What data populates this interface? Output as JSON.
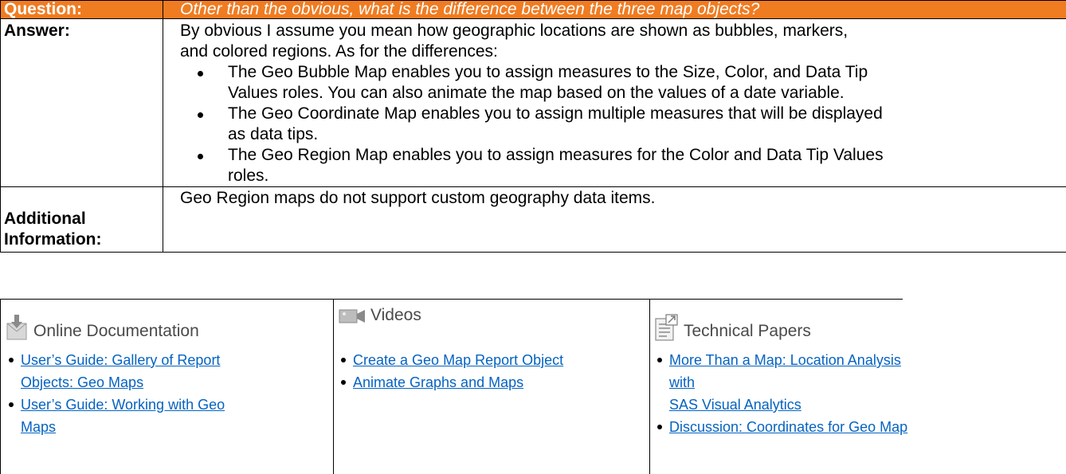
{
  "question": {
    "label": "Question:",
    "text": "Other than the obvious, what is the difference between the three map objects?"
  },
  "answer": {
    "label": "Answer:",
    "intro_line1": "By obvious I assume you mean how geographic locations are shown as bubbles, markers,",
    "intro_line2": "and colored regions. As for the differences:",
    "bullets": [
      {
        "line1": "The Geo Bubble Map enables you to assign measures to the Size, Color, and Data Tip",
        "line2": "Values roles. You can also animate the map based on the values of a date variable."
      },
      {
        "line1": "The Geo Coordinate Map enables you to assign multiple measures that will be displayed",
        "line2": "as data tips."
      },
      {
        "line1": "The Geo Region Map enables you to assign measures for the Color and Data Tip Values",
        "line2": "roles."
      }
    ]
  },
  "additional": {
    "label_line1": "Additional",
    "label_line2": "Information:",
    "text": "Geo Region maps do not support custom geography data items."
  },
  "resources": {
    "documentation": {
      "title": "Online Documentation",
      "icon": "document-download-icon",
      "links": [
        {
          "line1": "User’s Guide: Gallery of Report",
          "line2": "Objects: Geo Maps"
        },
        {
          "line1": "User’s Guide: Working with Geo",
          "line2": "Maps"
        }
      ]
    },
    "videos": {
      "title": "Videos",
      "icon": "video-camera-icon",
      "links": [
        {
          "line1": "Create a Geo Map Report Object"
        },
        {
          "line1": "Animate Graphs and Maps"
        }
      ]
    },
    "papers": {
      "title": "Technical Papers",
      "icon": "technical-paper-icon",
      "links": [
        {
          "line1": "More Than a Map: Location Analysis with",
          "line2": "SAS Visual Analytics"
        },
        {
          "line1": "Discussion: Coordinates for Geo Map"
        }
      ]
    }
  },
  "colors": {
    "header_orange": "#f07c22",
    "link_blue": "#0563c1"
  }
}
